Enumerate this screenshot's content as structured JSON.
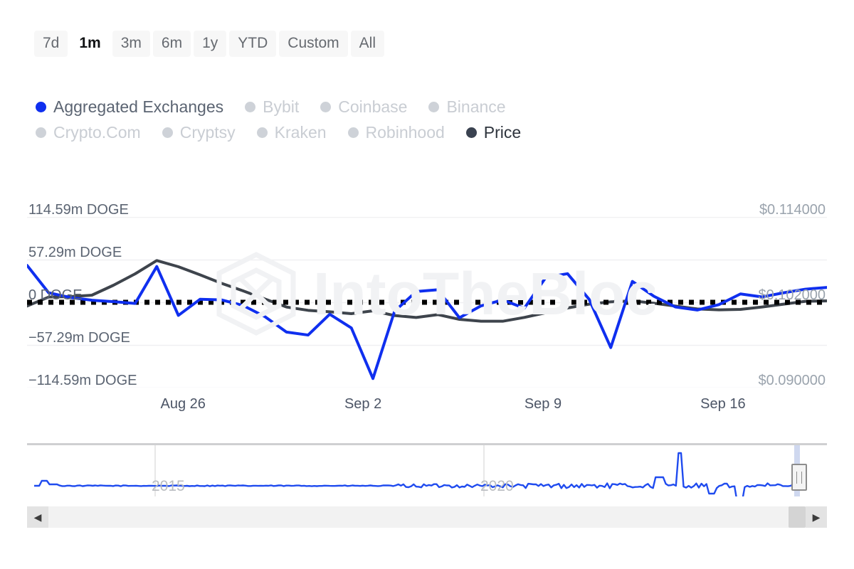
{
  "range_selector": {
    "options": [
      {
        "label": "7d",
        "active": false
      },
      {
        "label": "1m",
        "active": true
      },
      {
        "label": "3m",
        "active": false
      },
      {
        "label": "6m",
        "active": false
      },
      {
        "label": "1y",
        "active": false
      },
      {
        "label": "YTD",
        "active": false
      },
      {
        "label": "Custom",
        "active": false
      },
      {
        "label": "All",
        "active": false
      }
    ]
  },
  "legend": {
    "row1": [
      {
        "label": "Aggregated Exchanges",
        "color": "#0f2fef",
        "active": true
      },
      {
        "label": "Bybit",
        "color": "#ced2d8",
        "active": false
      },
      {
        "label": "Coinbase",
        "color": "#ced2d8",
        "active": false
      },
      {
        "label": "Binance",
        "color": "#ced2d8",
        "active": false
      }
    ],
    "row2": [
      {
        "label": "Crypto.Com",
        "color": "#ced2d8",
        "active": false
      },
      {
        "label": "Cryptsy",
        "color": "#ced2d8",
        "active": false
      },
      {
        "label": "Kraken",
        "color": "#ced2d8",
        "active": false
      },
      {
        "label": "Robinhood",
        "color": "#ced2d8",
        "active": false
      },
      {
        "label": "Price",
        "color": "#3a4250",
        "active": true
      }
    ]
  },
  "navigator": {
    "years": [
      "2015",
      "2020"
    ],
    "handle_label": "navigator-right-handle"
  },
  "scrollbar": {
    "left_arrow": "◀",
    "right_arrow": "▶"
  },
  "chart_data": {
    "type": "line",
    "title": "",
    "xlabel": "",
    "ylabel": "",
    "grid": true,
    "legend_position": "top",
    "x_ticks": [
      "Aug 26",
      "Sep 2",
      "Sep 9",
      "Sep 16"
    ],
    "x_tick_positions": [
      0.195,
      0.42,
      0.645,
      0.87
    ],
    "left_axis": {
      "label": "DOGE",
      "ticks": [
        "114.59m DOGE",
        "57.29m DOGE",
        "0 DOGE",
        "−57.29m DOGE",
        "−114.59m DOGE"
      ],
      "tick_values": [
        114590000,
        57290000,
        0,
        -57290000,
        -114590000
      ],
      "ylim": [
        -143240000,
        143240000
      ]
    },
    "right_axis": {
      "label": "Price",
      "ticks": [
        "$0.114000",
        "$0.102000",
        "$0.090000"
      ],
      "tick_values": [
        0.114,
        0.102,
        0.09
      ],
      "ylim": [
        0.084,
        0.12
      ]
    },
    "zero_line": {
      "value": 0,
      "style": "dotted",
      "color": "#000000"
    },
    "series": [
      {
        "name": "Aggregated Exchanges",
        "color": "#0f2fef",
        "axis": "left",
        "unit": "DOGE",
        "values": [
          62.0,
          16.0,
          8.0,
          3.5,
          1.0,
          -2.0,
          60.0,
          -22.0,
          5.0,
          4.0,
          -5.5,
          -24.0,
          -50.0,
          -55.0,
          -20.0,
          -43.0,
          -128.0,
          -15.0,
          18.0,
          21.0,
          -26.0,
          -6.0,
          4.0,
          -10.0,
          42.0,
          48.0,
          5.0,
          -76.0,
          35.0,
          10.0,
          -8.0,
          -13.0,
          -4.0,
          14.0,
          9.0,
          16.0,
          22.0,
          25.0
        ]
      },
      {
        "name": "Price",
        "color": "#3e444c",
        "axis": "right",
        "unit": "USD",
        "values": [
          0.1012,
          0.1031,
          0.1032,
          0.1035,
          0.1056,
          0.108,
          0.1108,
          0.1095,
          0.1078,
          0.106,
          0.1044,
          0.1027,
          0.101,
          0.1003,
          0.1,
          0.0996,
          0.1002,
          0.0992,
          0.0988,
          0.0994,
          0.0984,
          0.098,
          0.098,
          0.0988,
          0.0998,
          0.1008,
          0.1016,
          0.1021,
          0.1023,
          0.1018,
          0.1012,
          0.1006,
          0.1004,
          0.1005,
          0.101,
          0.1016,
          0.1022,
          0.1023
        ]
      }
    ],
    "navigator_series": {
      "name": "Aggregated Exchanges (full history)",
      "color": "#1f4bef",
      "x_labels": [
        "2015",
        "2020"
      ]
    },
    "watermark": "IntoTheBlock"
  }
}
